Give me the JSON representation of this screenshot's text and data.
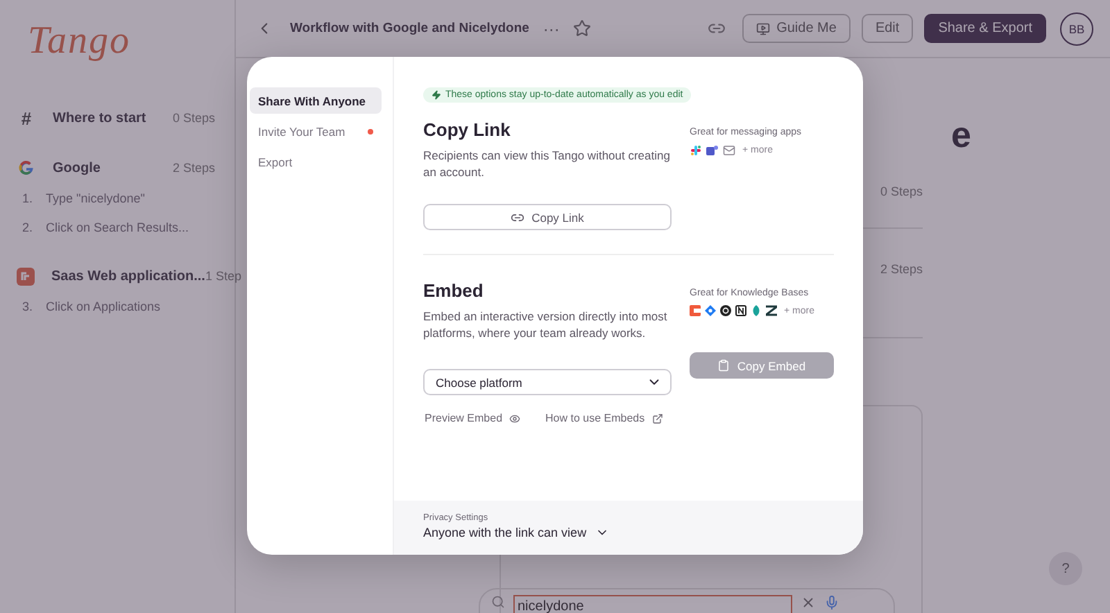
{
  "sidebar": {
    "logo": "Tango",
    "sections": [
      {
        "kind": "hash",
        "icon": "#",
        "title": "Where to start",
        "count": "0 Steps"
      },
      {
        "kind": "google",
        "title": "Google",
        "count": "2 Steps",
        "steps": [
          {
            "number": "1.",
            "label": "Type \"nicelydone\""
          },
          {
            "number": "2.",
            "label": "Click on Search Results..."
          }
        ]
      },
      {
        "kind": "app",
        "title": "Saas Web application...",
        "count": "1 Step",
        "steps": [
          {
            "number": "3.",
            "label": "Click on Applications"
          }
        ]
      }
    ]
  },
  "header": {
    "title": "Workflow with Google and Nicelydone",
    "more": "···",
    "guide_button": "Guide Me",
    "edit_button": "Edit",
    "share_button": "Share & Export",
    "avatar": "BB"
  },
  "content": {
    "title_fragment": "e",
    "rows": [
      {
        "count": "0 Steps"
      },
      {
        "count": "2 Steps"
      }
    ],
    "search": {
      "value": "nicelydone"
    },
    "help": "?"
  },
  "modal": {
    "nav": [
      {
        "label": "Share With Anyone",
        "selected": true,
        "dot": false
      },
      {
        "label": "Invite Your Team",
        "selected": false,
        "dot": true
      },
      {
        "label": "Export",
        "selected": false,
        "dot": false
      }
    ],
    "notice": "These options stay up-to-date automatically as you edit",
    "sections": [
      {
        "kind": "link",
        "title": "Copy Link",
        "description": "Recipients can view this Tango without creating an account.",
        "apps_label": "Great for messaging apps",
        "more": "+ more",
        "button": "Copy Link",
        "disabled": false
      },
      {
        "kind": "embed",
        "title": "Embed",
        "description": "Embed an interactive version directly into most platforms, where your team already works.",
        "apps_label": "Great for Knowledge Bases",
        "more": "+ more",
        "select": "Choose platform",
        "button": "Copy Embed",
        "disabled": true,
        "links": [
          {
            "kind": "preview",
            "label": "Preview Embed"
          },
          {
            "kind": "external",
            "label": "How to use Embeds"
          }
        ]
      }
    ],
    "privacy": {
      "label": "Privacy Settings",
      "value": "Anyone with the link can view"
    }
  }
}
